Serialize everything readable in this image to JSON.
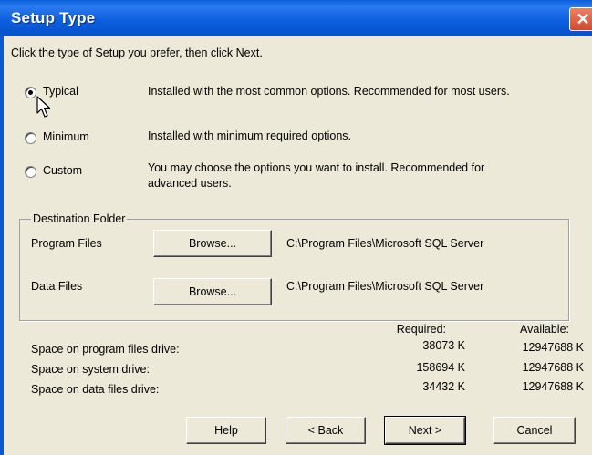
{
  "window": {
    "title": "Setup Type"
  },
  "instruction": "Click the type of Setup you prefer, then click Next.",
  "setup_options": [
    {
      "label": "Typical",
      "description": "Installed with the most common options. Recommended for most users.",
      "selected": true
    },
    {
      "label": "Minimum",
      "description": "Installed with minimum required options.",
      "selected": false
    },
    {
      "label": "Custom",
      "description_line1": "You may choose the options you want to install. Recommended for",
      "description_line2": "advanced users.",
      "selected": false
    }
  ],
  "destination": {
    "legend": "Destination Folder",
    "program_files": {
      "label": "Program Files",
      "button": "Browse...",
      "path": "C:\\Program Files\\Microsoft SQL Server"
    },
    "data_files": {
      "label": "Data Files",
      "button": "Browse...",
      "path": "C:\\Program Files\\Microsoft SQL Server"
    }
  },
  "space": {
    "required_header": "Required:",
    "available_header": "Available:",
    "rows": [
      {
        "label": "Space on program files drive:",
        "required": "38073 K",
        "available": "12947688 K"
      },
      {
        "label": "Space on system drive:",
        "required": "158694 K",
        "available": "12947688 K"
      },
      {
        "label": "Space on data files drive:",
        "required": "34432 K",
        "available": "12947688 K"
      }
    ]
  },
  "buttons": {
    "help": "Help",
    "back": "< Back",
    "next": "Next >",
    "cancel": "Cancel"
  },
  "icons": {
    "close": "close-icon",
    "cursor": "mouse-pointer-icon"
  }
}
